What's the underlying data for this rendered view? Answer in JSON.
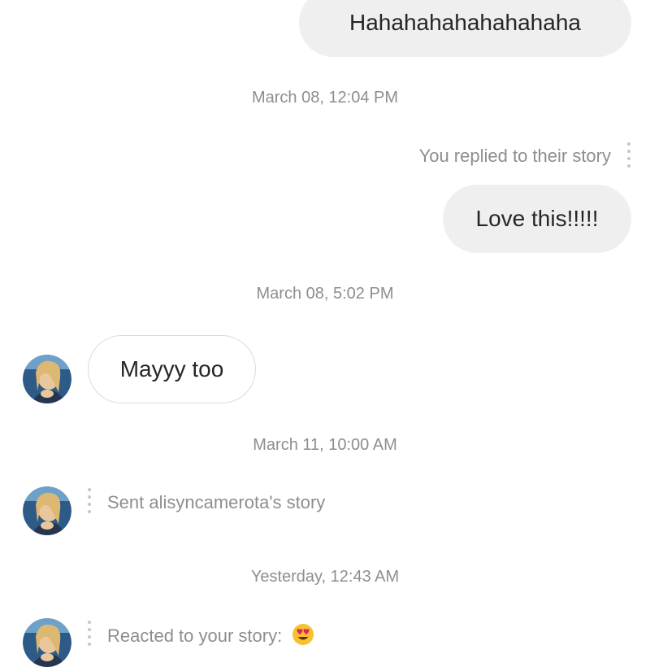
{
  "messages": {
    "outgoing_1": "Hahahahahahahahaha",
    "timestamp_1": "March 08, 12:04 PM",
    "story_reply_label": "You replied to their story",
    "outgoing_2": "Love this!!!!!",
    "timestamp_2": "March 08, 5:02 PM",
    "incoming_1": "Mayyy too",
    "timestamp_3": "March 11, 10:00 AM",
    "sent_story": "Sent alisyncamerota's story",
    "timestamp_4": "Yesterday, 12:43 AM",
    "reacted_story": "Reacted to your story:"
  },
  "icons": {
    "reaction_emoji": "heart-eyes-emoji",
    "options": "vertical-dots-icon"
  },
  "colors": {
    "outgoing_bubble": "#efefef",
    "text": "#262626",
    "secondary_text": "#8e8e8e",
    "incoming_border": "#dbdbdb"
  }
}
